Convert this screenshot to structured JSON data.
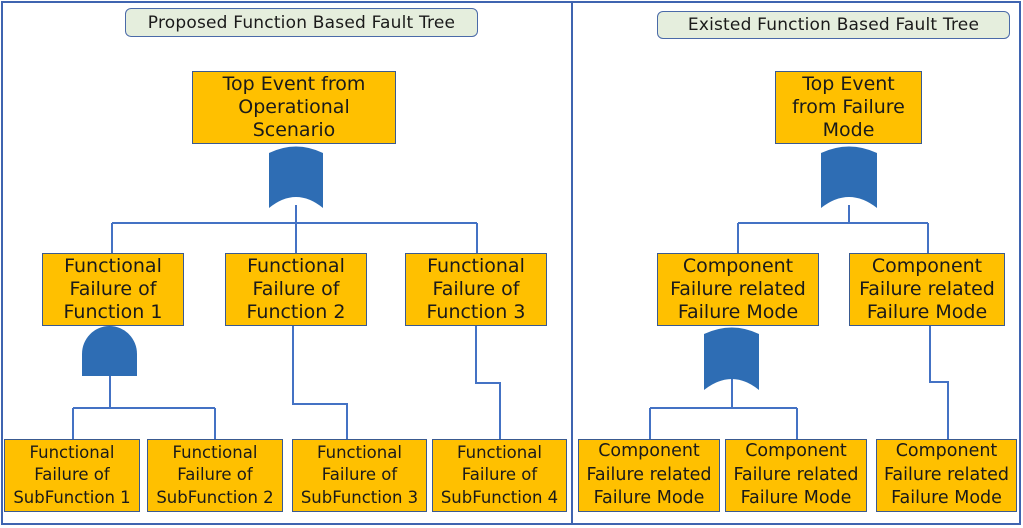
{
  "colors": {
    "node_fill": "#ffc000",
    "gate_fill": "#2e6db4",
    "line": "#4472c4",
    "panel_border": "#3f64b0",
    "title_fill": "#e5eedd"
  },
  "left_panel": {
    "title": "Proposed Function Based Fault Tree",
    "top_event": "Top Event from\nOperational\nScenario",
    "top_gate": "or-gate",
    "functions": [
      {
        "label": "Functional\nFailure of\nFunction 1",
        "gate": "and-gate"
      },
      {
        "label": "Functional\nFailure of\nFunction 2",
        "gate": "none"
      },
      {
        "label": "Functional\nFailure of\nFunction 3",
        "gate": "none"
      }
    ],
    "subfunctions": [
      {
        "label": "Functional\nFailure of\nSubFunction 1",
        "parent": 0
      },
      {
        "label": "Functional\nFailure of\nSubFunction 2",
        "parent": 0
      },
      {
        "label": "Functional\nFailure of\nSubFunction 3",
        "parent": 1
      },
      {
        "label": "Functional\nFailure of\nSubFunction 4",
        "parent": 2
      }
    ]
  },
  "right_panel": {
    "title": "Existed Function Based Fault Tree",
    "top_event": "Top Event\nfrom Failure\nMode",
    "top_gate": "or-gate",
    "components": [
      {
        "label": "Component\nFailure related\nFailure Mode",
        "gate": "or-gate"
      },
      {
        "label": "Component\nFailure related\nFailure Mode",
        "gate": "none"
      }
    ],
    "leaves": [
      {
        "label": "Component\nFailure related\nFailure Mode",
        "parent": 0
      },
      {
        "label": "Component\nFailure related\nFailure Mode",
        "parent": 0
      },
      {
        "label": "Component\nFailure related\nFailure Mode",
        "parent": 1
      }
    ]
  }
}
